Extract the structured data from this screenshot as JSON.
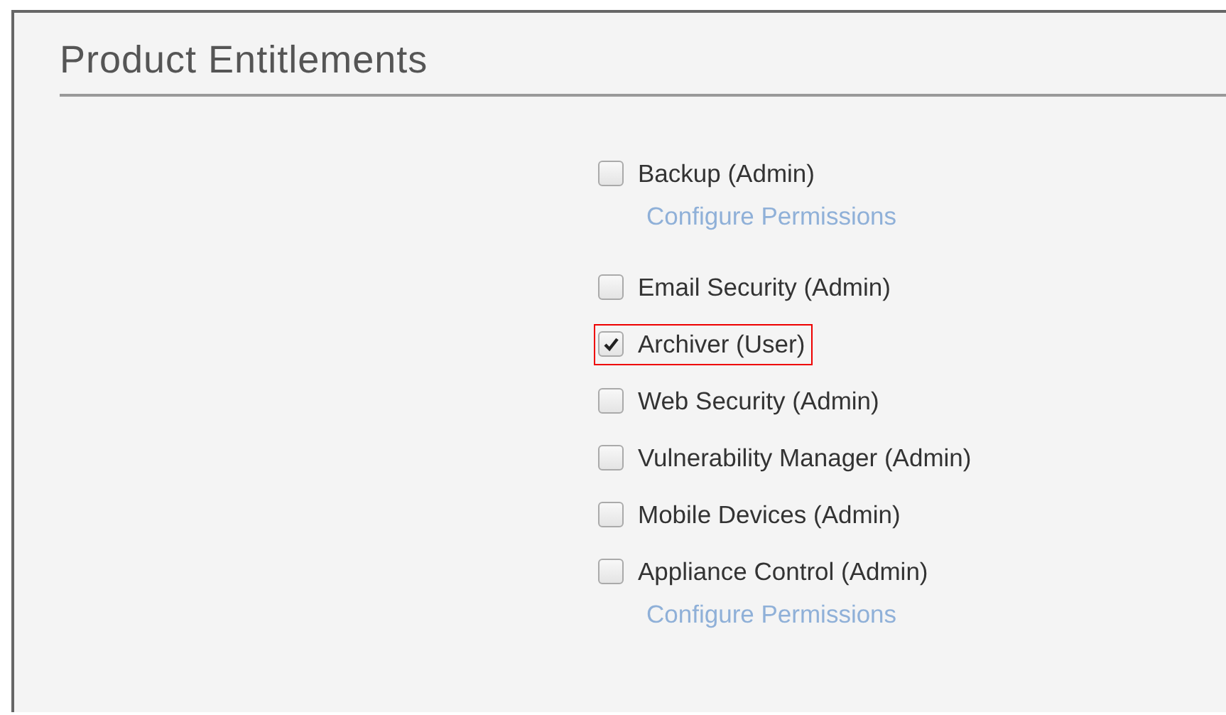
{
  "title": "Product Entitlements",
  "entitlements": [
    {
      "label": "Backup (Admin)",
      "checked": false,
      "highlighted": false,
      "link": {
        "label": "Configure Permissions",
        "disabled": true
      }
    },
    {
      "label": "Email Security (Admin)",
      "checked": false,
      "highlighted": false
    },
    {
      "label": "Archiver (User)",
      "checked": true,
      "highlighted": true
    },
    {
      "label": "Web Security (Admin)",
      "checked": false,
      "highlighted": false
    },
    {
      "label": "Vulnerability Manager (Admin)",
      "checked": false,
      "highlighted": false
    },
    {
      "label": "Mobile Devices (Admin)",
      "checked": false,
      "highlighted": false
    },
    {
      "label": "Appliance Control (Admin)",
      "checked": false,
      "highlighted": false,
      "link": {
        "label": "Configure Permissions",
        "disabled": true
      }
    }
  ]
}
